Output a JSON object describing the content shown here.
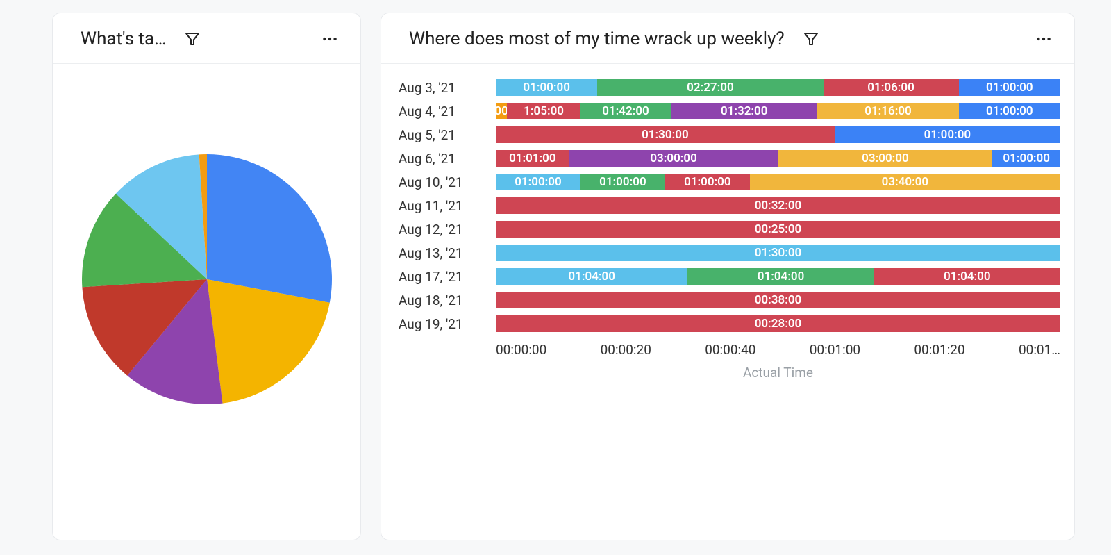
{
  "colors": {
    "blue": "#4285f4",
    "yellow": "#f4b400",
    "purple": "#8e44ad",
    "red": "#c0392b",
    "green": "#4caf50",
    "sky": "#6ec6f0",
    "orange": "#f39c12",
    "redBright": "#cf4553",
    "greenBright": "#48b26b",
    "skyBright": "#5bc0eb",
    "blueBright": "#3b82f6",
    "yellowBright": "#f1b63c",
    "purpleBright": "#8e44ad"
  },
  "left_card": {
    "title": "What's ta…"
  },
  "right_card": {
    "title": "Where does most of my time wrack up weekly?",
    "xaxis_label": "Actual Time",
    "xaxis_ticks": [
      "00:00:00",
      "00:00:20",
      "00:00:40",
      "00:01:00",
      "00:01:20",
      "00:01…"
    ]
  },
  "chart_data": [
    {
      "type": "pie",
      "title": "What's ta…",
      "series": [
        {
          "name": "blue",
          "value": 28,
          "color": "#4285f4"
        },
        {
          "name": "yellow",
          "value": 20,
          "color": "#f4b400"
        },
        {
          "name": "purple",
          "value": 13,
          "color": "#8e44ad"
        },
        {
          "name": "red",
          "value": 13,
          "color": "#c0392b"
        },
        {
          "name": "green",
          "value": 13,
          "color": "#4caf50"
        },
        {
          "name": "sky",
          "value": 12,
          "color": "#6ec6f0"
        },
        {
          "name": "orange",
          "value": 1,
          "color": "#f39c12"
        }
      ]
    },
    {
      "type": "stacked-bar-horizontal",
      "title": "Where does most of my time wrack up weekly?",
      "xlabel": "Actual Time",
      "xticks": [
        "00:00:00",
        "00:00:20",
        "00:00:40",
        "00:01:00",
        "00:01:20",
        "00:01…"
      ],
      "categories": [
        "Aug 3, '21",
        "Aug 4, '21",
        "Aug 5, '21",
        "Aug 6, '21",
        "Aug 10, '21",
        "Aug 11, '21",
        "Aug 12, '21",
        "Aug 13, '21",
        "Aug 17, '21",
        "Aug 18, '21",
        "Aug 19, '21"
      ],
      "rows": [
        {
          "date": "Aug 3, '21",
          "segments": [
            {
              "label": "01:00:00",
              "color": "sky",
              "pct": 18
            },
            {
              "label": "02:27:00",
              "color": "green",
              "pct": 40
            },
            {
              "label": "01:06:00",
              "color": "red",
              "pct": 24
            },
            {
              "label": "01:00:00",
              "color": "blue",
              "pct": 18
            }
          ]
        },
        {
          "date": "Aug 4, '21",
          "segments": [
            {
              "label": "00",
              "color": "orange",
              "pct": 2
            },
            {
              "label": "1:05:00",
              "color": "red",
              "pct": 13
            },
            {
              "label": "01:42:00",
              "color": "green",
              "pct": 16
            },
            {
              "label": "01:32:00",
              "color": "purple",
              "pct": 26
            },
            {
              "label": "01:16:00",
              "color": "yellow",
              "pct": 25
            },
            {
              "label": "01:00:00",
              "color": "blue",
              "pct": 18
            }
          ]
        },
        {
          "date": "Aug 5, '21",
          "segments": [
            {
              "label": "01:30:00",
              "color": "red",
              "pct": 60
            },
            {
              "label": "01:00:00",
              "color": "blue",
              "pct": 40
            }
          ]
        },
        {
          "date": "Aug 6, '21",
          "segments": [
            {
              "label": "01:01:00",
              "color": "red",
              "pct": 13
            },
            {
              "label": "03:00:00",
              "color": "purple",
              "pct": 37
            },
            {
              "label": "03:00:00",
              "color": "yellow",
              "pct": 38
            },
            {
              "label": "01:00:00",
              "color": "blue",
              "pct": 12
            }
          ]
        },
        {
          "date": "Aug 10, '21",
          "segments": [
            {
              "label": "01:00:00",
              "color": "sky",
              "pct": 15
            },
            {
              "label": "01:00:00",
              "color": "green",
              "pct": 15
            },
            {
              "label": "01:00:00",
              "color": "red",
              "pct": 15
            },
            {
              "label": "03:40:00",
              "color": "yellow",
              "pct": 55
            }
          ]
        },
        {
          "date": "Aug 11, '21",
          "segments": [
            {
              "label": "00:32:00",
              "color": "red",
              "pct": 100
            }
          ]
        },
        {
          "date": "Aug 12, '21",
          "segments": [
            {
              "label": "00:25:00",
              "color": "red",
              "pct": 100
            }
          ]
        },
        {
          "date": "Aug 13, '21",
          "segments": [
            {
              "label": "01:30:00",
              "color": "sky",
              "pct": 100
            }
          ]
        },
        {
          "date": "Aug 17, '21",
          "segments": [
            {
              "label": "01:04:00",
              "color": "sky",
              "pct": 34
            },
            {
              "label": "01:04:00",
              "color": "green",
              "pct": 33
            },
            {
              "label": "01:04:00",
              "color": "red",
              "pct": 33
            }
          ]
        },
        {
          "date": "Aug 18, '21",
          "segments": [
            {
              "label": "00:38:00",
              "color": "red",
              "pct": 100
            }
          ]
        },
        {
          "date": "Aug 19, '21",
          "segments": [
            {
              "label": "00:28:00",
              "color": "red",
              "pct": 100
            }
          ]
        }
      ]
    }
  ]
}
